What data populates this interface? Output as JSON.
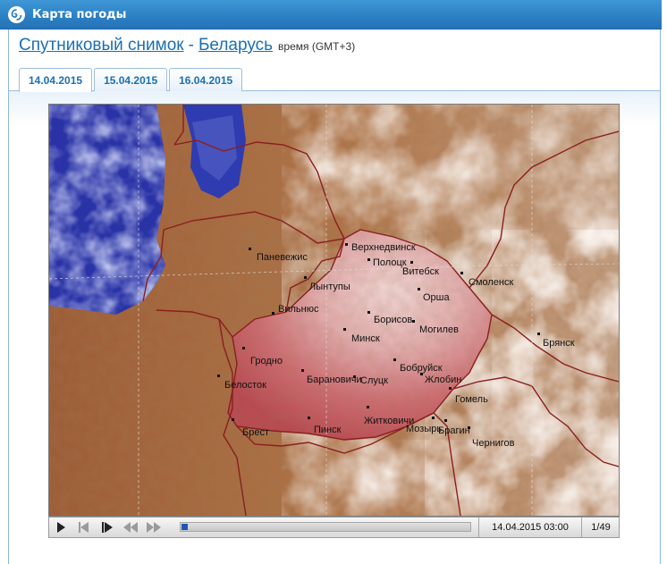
{
  "header": {
    "title": "Карта погоды",
    "logo_icon": "weather-logo-icon"
  },
  "heading": {
    "link_product": "Спутниковый снимок",
    "separator": "-",
    "link_region": "Беларусь",
    "time_note": "время (GMT+3)"
  },
  "tabs": [
    {
      "label": "14.04.2015",
      "active": true
    },
    {
      "label": "15.04.2015",
      "active": false
    },
    {
      "label": "16.04.2015",
      "active": false
    }
  ],
  "map": {
    "cities": [
      {
        "name": "Верхнедвинск"
      },
      {
        "name": "Полоцк"
      },
      {
        "name": "Витебск"
      },
      {
        "name": "Смоленск"
      },
      {
        "name": "Паневежис"
      },
      {
        "name": "Лынтупы"
      },
      {
        "name": "Орша"
      },
      {
        "name": "Вильнюс"
      },
      {
        "name": "Борисов"
      },
      {
        "name": "Минск"
      },
      {
        "name": "Могилев"
      },
      {
        "name": "Брянск"
      },
      {
        "name": "Гродно"
      },
      {
        "name": "Бобруйск"
      },
      {
        "name": "Белосток"
      },
      {
        "name": "Барановичи"
      },
      {
        "name": "Слуцк"
      },
      {
        "name": "Жлобин"
      },
      {
        "name": "Гомель"
      },
      {
        "name": "Житковичи"
      },
      {
        "name": "Брест"
      },
      {
        "name": "Пинск"
      },
      {
        "name": "Мозырь"
      },
      {
        "name": "Брагин"
      },
      {
        "name": "Чернигов"
      }
    ]
  },
  "player": {
    "controls": [
      "play-icon",
      "step-back-icon",
      "step-forward-icon",
      "rewind-icon",
      "fast-forward-icon"
    ],
    "progress": 0.02,
    "timestamp": "14.04.2015 03:00",
    "frame_counter": "1/49"
  }
}
